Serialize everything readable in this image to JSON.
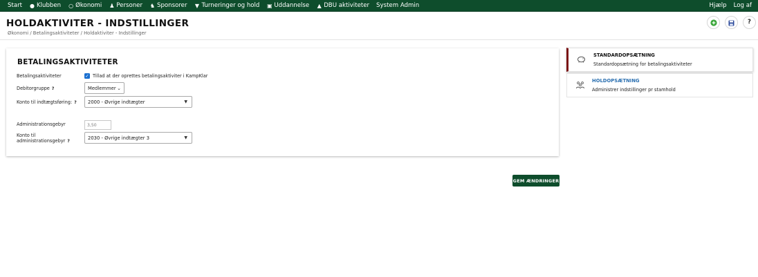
{
  "nav": {
    "items": [
      {
        "label": "Start",
        "icon": ""
      },
      {
        "label": "Klubben",
        "icon": "group-icon"
      },
      {
        "label": "Økonomi",
        "icon": "coin-icon"
      },
      {
        "label": "Personer",
        "icon": "person-icon"
      },
      {
        "label": "Sponsorer",
        "icon": "sponsor-icon"
      },
      {
        "label": "Turneringer og hold",
        "icon": "trophy-icon"
      },
      {
        "label": "Uddannelse",
        "icon": "screen-icon"
      },
      {
        "label": "DBU aktiviteter",
        "icon": "graduation-icon"
      },
      {
        "label": "System Admin",
        "icon": ""
      }
    ],
    "right": [
      {
        "label": "Hjælp"
      },
      {
        "label": "Log af"
      }
    ]
  },
  "header": {
    "title": "HOLDAKTIVITER - INDSTILLINGER",
    "breadcrumb": "Økonomi / Betalingsaktiviteter / Holdaktiviter - Indstillinger",
    "buttons": {
      "add_icon": "plus-circle-icon",
      "save_icon": "floppy-icon",
      "help_symbol": "?"
    },
    "colors": {
      "add": "#3aa63a",
      "save": "#2c4a9a"
    }
  },
  "card": {
    "title": "BETALINGSAKTIVITETER",
    "betalingsaktiviteter_label": "Betalingsaktiviteter",
    "allow_checkbox_label": "Tillad at der oprettes betalingsaktiviter i KampKlar",
    "allow_checked": true,
    "debitorgruppe_label": "Debitorgruppe",
    "debitorgruppe_value": "Medlemmer",
    "konto_label": "Konto til indtægtsføring:",
    "konto_value": "2000 - Øvrige indtægter",
    "admin_fee_label": "Administrationsgebyr",
    "admin_fee_placeholder": "3,50",
    "admin_konto_label_line1": "Konto til",
    "admin_konto_label_line2": "administrationsgebyr",
    "admin_konto_value": "2030 - Øvrige indtægter 3",
    "help_mark": "?"
  },
  "actions": {
    "save_label": "GEM ÆNDRINGER"
  },
  "side": [
    {
      "title": "STANDARDOPSÆTNING",
      "desc": "Standardopsætning for betalingsaktiviteter",
      "icon": "piggy-bank-icon",
      "active": true
    },
    {
      "title": "HOLDOPSÆTNING",
      "desc": "Administrer indstillinger pr stamhold",
      "icon": "team-icon",
      "active": false
    }
  ],
  "colors": {
    "nav_bg": "#0e4d2c",
    "accent_active": "#7a1214",
    "link_blue": "#2a6fb0"
  }
}
